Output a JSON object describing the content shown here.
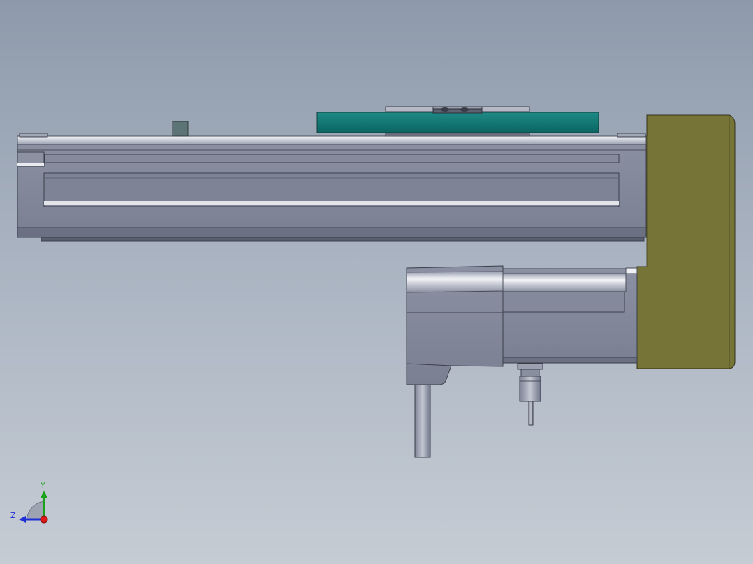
{
  "triad": {
    "x_axis_label": "",
    "y_axis_label": "Y",
    "z_axis_label": "Z",
    "y_axis_color": "#1aa31a",
    "z_axis_color": "#1f2fd6",
    "x_axis_color": "#e01818"
  },
  "colors": {
    "background_top": "#8e9aab",
    "background_bottom": "#c6ccd4",
    "actuator_body": "#7f8597",
    "carriage_plate": "#0e7470",
    "motor_housing": "#767436",
    "edge_highlight": "#eef0f5"
  }
}
